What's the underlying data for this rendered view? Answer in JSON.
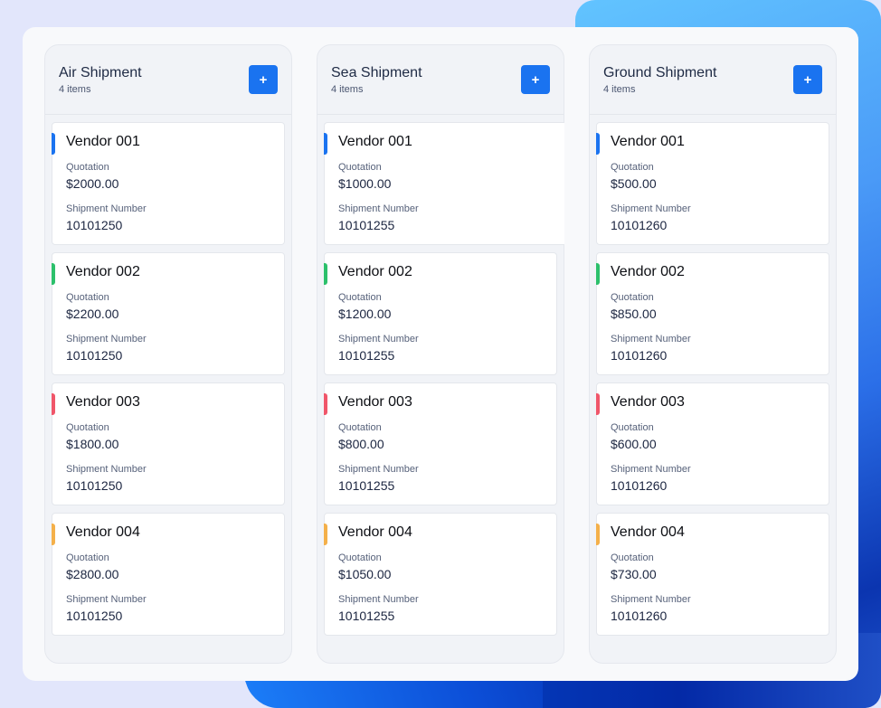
{
  "colors": {
    "accent_blue": "#1a73f0",
    "vendor_001": "#1a73f0",
    "vendor_002": "#2cc06b",
    "vendor_003": "#f0566a",
    "vendor_004": "#f4b04a"
  },
  "add_icon": "+",
  "columns": [
    {
      "title": "Air Shipment",
      "count": "4 items",
      "cards": [
        {
          "vendor": "Vendor 001",
          "quotation_label": "Quotation",
          "quotation": "$2000.00",
          "shipment_label": "Shipment Number",
          "shipment": "10101250"
        },
        {
          "vendor": "Vendor 002",
          "quotation_label": "Quotation",
          "quotation": "$2200.00",
          "shipment_label": "Shipment Number",
          "shipment": "10101250"
        },
        {
          "vendor": "Vendor 003",
          "quotation_label": "Quotation",
          "quotation": "$1800.00",
          "shipment_label": "Shipment Number",
          "shipment": "10101250"
        },
        {
          "vendor": "Vendor 004",
          "quotation_label": "Quotation",
          "quotation": "$2800.00",
          "shipment_label": "Shipment Number",
          "shipment": "10101250"
        }
      ]
    },
    {
      "title": "Sea Shipment",
      "count": "4 items",
      "cards": [
        {
          "vendor": "Vendor 001",
          "quotation_label": "Quotation",
          "quotation": "$1000.00",
          "shipment_label": "Shipment Number",
          "shipment": "10101255"
        },
        {
          "vendor": "Vendor 002",
          "quotation_label": "Quotation",
          "quotation": "$1200.00",
          "shipment_label": "Shipment Number",
          "shipment": "10101255"
        },
        {
          "vendor": "Vendor 003",
          "quotation_label": "Quotation",
          "quotation": "$800.00",
          "shipment_label": "Shipment Number",
          "shipment": "10101255"
        },
        {
          "vendor": "Vendor 004",
          "quotation_label": "Quotation",
          "quotation": "$1050.00",
          "shipment_label": "Shipment Number",
          "shipment": "10101255"
        }
      ]
    },
    {
      "title": "Ground Shipment",
      "count": "4 items",
      "cards": [
        {
          "vendor": "Vendor 001",
          "quotation_label": "Quotation",
          "quotation": "$500.00",
          "shipment_label": "Shipment Number",
          "shipment": "10101260"
        },
        {
          "vendor": "Vendor 002",
          "quotation_label": "Quotation",
          "quotation": "$850.00",
          "shipment_label": "Shipment Number",
          "shipment": "10101260"
        },
        {
          "vendor": "Vendor 003",
          "quotation_label": "Quotation",
          "quotation": "$600.00",
          "shipment_label": "Shipment Number",
          "shipment": "10101260"
        },
        {
          "vendor": "Vendor 004",
          "quotation_label": "Quotation",
          "quotation": "$730.00",
          "shipment_label": "Shipment Number",
          "shipment": "10101260"
        }
      ]
    }
  ]
}
